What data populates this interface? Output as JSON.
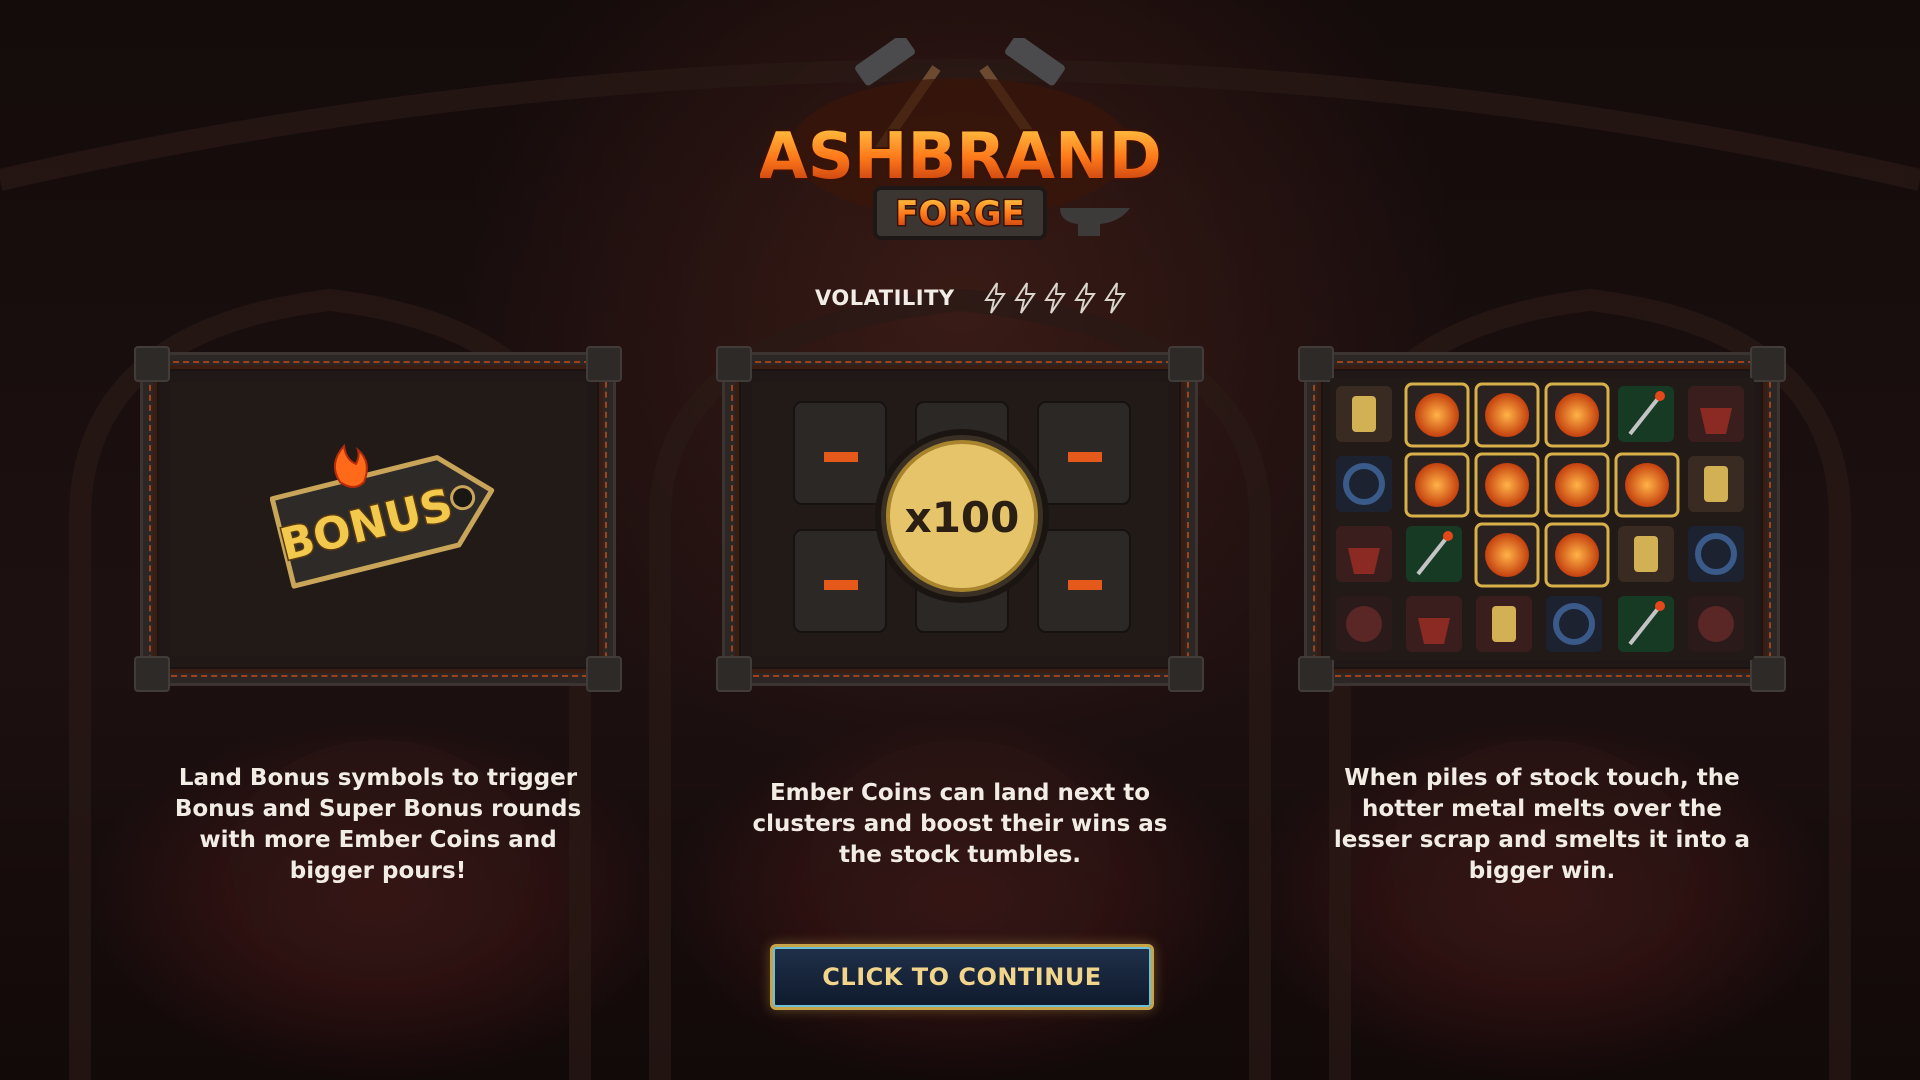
{
  "logo": {
    "line1": "ASHBRAND",
    "line2": "FORGE"
  },
  "volatility": {
    "label": "VOLATILITY",
    "level": 5,
    "max": 5
  },
  "panels": [
    {
      "name": "bonus",
      "tag_text": "BONUS",
      "description": "Land Bonus symbols to trigger Bonus and Super Bonus rounds with more Ember Coins and bigger pours!"
    },
    {
      "name": "ember-coin",
      "coin_text": "x100",
      "description": "Ember Coins can land next to clusters and boost their wins as the stock tumbles."
    },
    {
      "name": "clusters",
      "description": "When piles of stock touch, the hotter metal melts over the lesser scrap and smelts it into a bigger win."
    }
  ],
  "continue_button": {
    "label": "CLICK TO CONTINUE"
  },
  "colors": {
    "accent_gold": "#c8a449",
    "lava": "#ff5a14",
    "button_bg": "#162338"
  }
}
